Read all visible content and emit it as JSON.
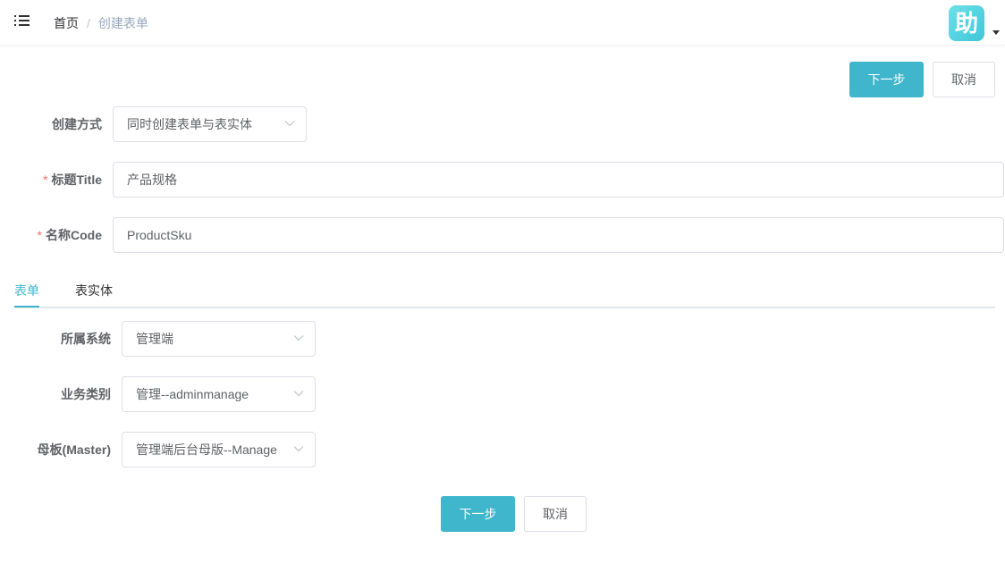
{
  "header": {
    "breadcrumb": {
      "home": "首页",
      "separator": "/",
      "current": "创建表单"
    },
    "avatar_text": "助",
    "avatar_color": "#4fd0e0"
  },
  "toolbar_top": {
    "next_label": "下一步",
    "cancel_label": "取消"
  },
  "form": {
    "create_mode": {
      "label": "创建方式",
      "value": "同时创建表单与表实体"
    },
    "title": {
      "required_mark": "*",
      "label": "标题Title",
      "value": "产品规格"
    },
    "code": {
      "required_mark": "*",
      "label": "名称Code",
      "value": "ProductSku"
    }
  },
  "tabs": [
    {
      "label": "表单",
      "active": true
    },
    {
      "label": "表实体",
      "active": false
    }
  ],
  "tab_form": {
    "system": {
      "label": "所属系统",
      "value": "管理端"
    },
    "category": {
      "label": "业务类别",
      "value": "管理--adminmanage"
    },
    "master": {
      "label": "母板(Master)",
      "value": "管理端后台母版--Manage"
    }
  },
  "toolbar_bottom": {
    "next_label": "下一步",
    "cancel_label": "取消"
  },
  "colors": {
    "primary": "#3fb6cc",
    "required": "#f56c6c",
    "border": "#dcdfe6"
  }
}
